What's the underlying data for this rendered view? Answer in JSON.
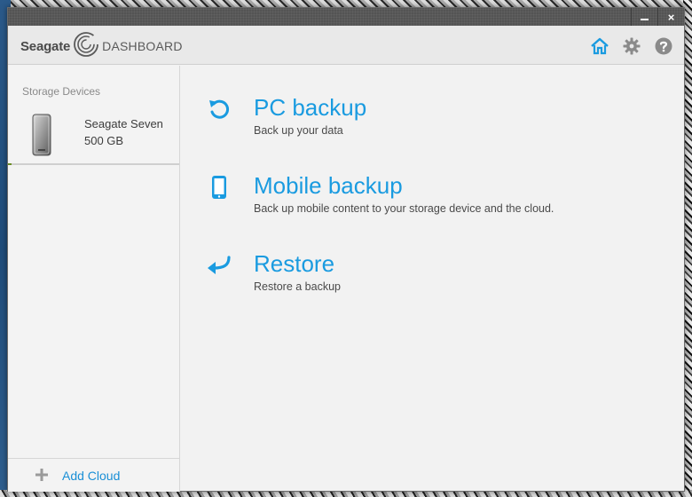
{
  "app": {
    "brand": "Seagate",
    "name": "DASHBOARD"
  },
  "window_controls": {
    "minimize_icon": "minimize-icon",
    "close_label": "×"
  },
  "header_icons": [
    {
      "name": "home-icon",
      "active": true
    },
    {
      "name": "gear-icon",
      "active": false
    },
    {
      "name": "help-icon",
      "active": false
    }
  ],
  "colors": {
    "accent": "#1a9be0",
    "link": "#1a8fd6",
    "icon_inactive": "#8a8a8a"
  },
  "sidebar": {
    "heading": "Storage Devices",
    "devices": [
      {
        "name": "Seagate Seven",
        "size": "500 GB",
        "icon": "hard-drive-icon"
      }
    ],
    "footer": {
      "label": "Add Cloud",
      "icon": "plus-icon"
    }
  },
  "actions": [
    {
      "title": "PC backup",
      "description": "Back up your data",
      "icon": "backup-arrow-icon"
    },
    {
      "title": "Mobile backup",
      "description": "Back up mobile content to your storage device and the cloud.",
      "icon": "mobile-phone-icon"
    },
    {
      "title": "Restore",
      "description": "Restore a backup",
      "icon": "restore-arrow-icon"
    }
  ]
}
